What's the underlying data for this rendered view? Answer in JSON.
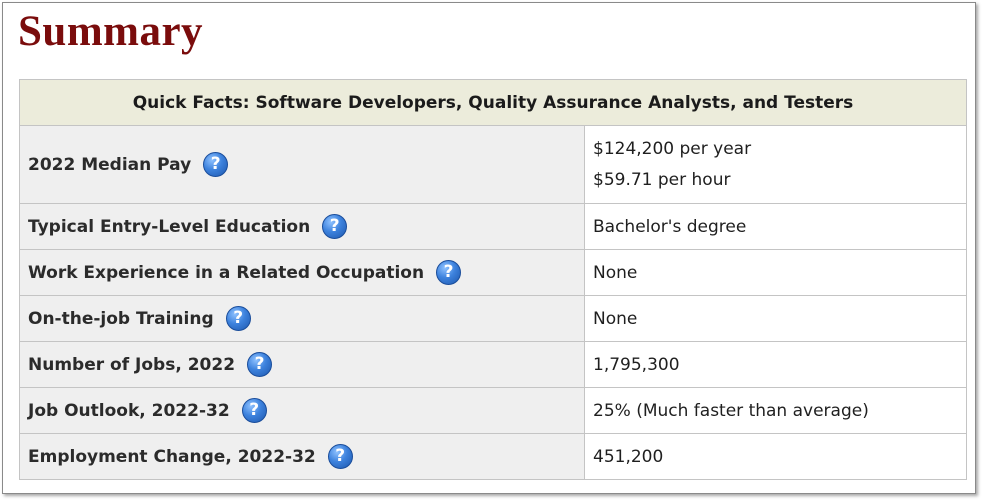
{
  "title": "Summary",
  "table": {
    "header": "Quick Facts: Software Developers, Quality Assurance Analysts, and Testers",
    "help_icon": "question-mark-icon",
    "rows": [
      {
        "label": "2022 Median Pay",
        "value": "$124,200 per year",
        "value2": "$59.71 per hour"
      },
      {
        "label": "Typical Entry-Level Education",
        "value": "Bachelor's degree"
      },
      {
        "label": "Work Experience in a Related Occupation",
        "value": "None"
      },
      {
        "label": "On-the-job Training",
        "value": "None"
      },
      {
        "label": "Number of Jobs, 2022",
        "value": "1,795,300"
      },
      {
        "label": "Job Outlook, 2022-32",
        "value": "25% (Much faster than average)"
      },
      {
        "label": "Employment Change, 2022-32",
        "value": "451,200"
      }
    ]
  },
  "colors": {
    "title": "#7a0c0c",
    "header_bg": "#ececdb",
    "label_bg": "#efefef",
    "help_icon": "#3d82dd"
  }
}
